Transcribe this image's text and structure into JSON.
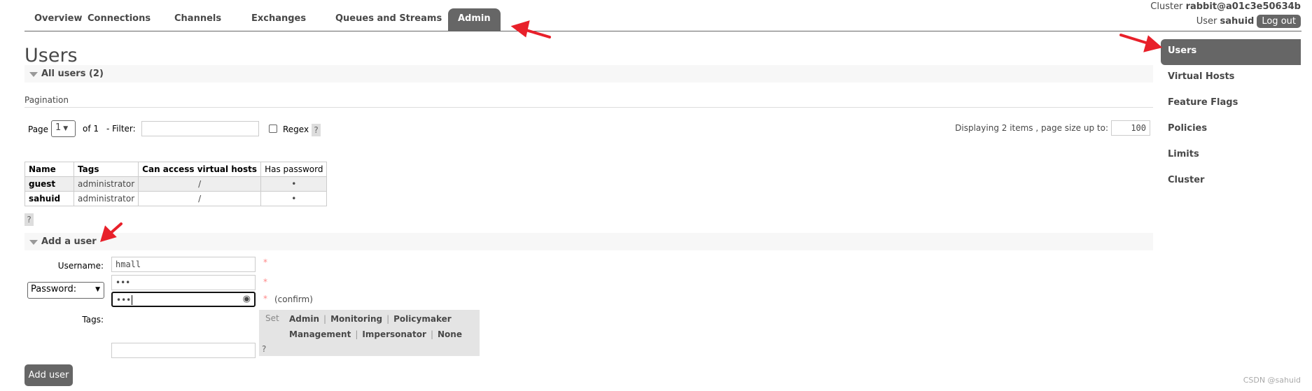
{
  "tabs": [
    "Overview",
    "Connections",
    "Channels",
    "Exchanges",
    "Queues and Streams",
    "Admin"
  ],
  "active_tab": "Admin",
  "header": {
    "cluster_label": "Cluster",
    "cluster_name": "rabbit@a01c3e50634b",
    "user_label": "User",
    "user_name": "sahuid",
    "logout": "Log out"
  },
  "sidebar": {
    "items": [
      "Users",
      "Virtual Hosts",
      "Feature Flags",
      "Policies",
      "Limits",
      "Cluster"
    ],
    "active": "Users"
  },
  "page_title": "Users",
  "all_users": {
    "title": "All users (2)"
  },
  "pagination": {
    "label": "Pagination",
    "page_label": "Page",
    "page_value": "1",
    "of": "of 1",
    "filter_label": "- Filter:",
    "filter_value": "",
    "regex_label": "Regex",
    "help": "?",
    "displaying": "Displaying 2 items , page size up to:",
    "page_size": "100"
  },
  "table": {
    "headers": [
      "Name",
      "Tags",
      "Can access virtual hosts",
      "Has password"
    ],
    "rows": [
      [
        "guest",
        "administrator",
        "/",
        "•"
      ],
      [
        "sahuid",
        "administrator",
        "/",
        "•"
      ]
    ]
  },
  "help": "?",
  "add_user": {
    "title": "Add a user",
    "username_label": "Username:",
    "username_value": "hmall",
    "password_select": "Password:",
    "password_mask": "•••",
    "confirm_mask": "•••",
    "required": "*",
    "confirm_label": "(confirm)",
    "tags_label": "Tags:",
    "tags_value": "",
    "set_label": "Set",
    "tags": [
      "Admin",
      "Monitoring",
      "Policymaker",
      "Management",
      "Impersonator",
      "None"
    ],
    "help": "?",
    "submit": "Add user"
  },
  "watermark": "CSDN @sahuid",
  "colors": {
    "accent": "#666666",
    "annotation_arrow": "#e8202a"
  }
}
